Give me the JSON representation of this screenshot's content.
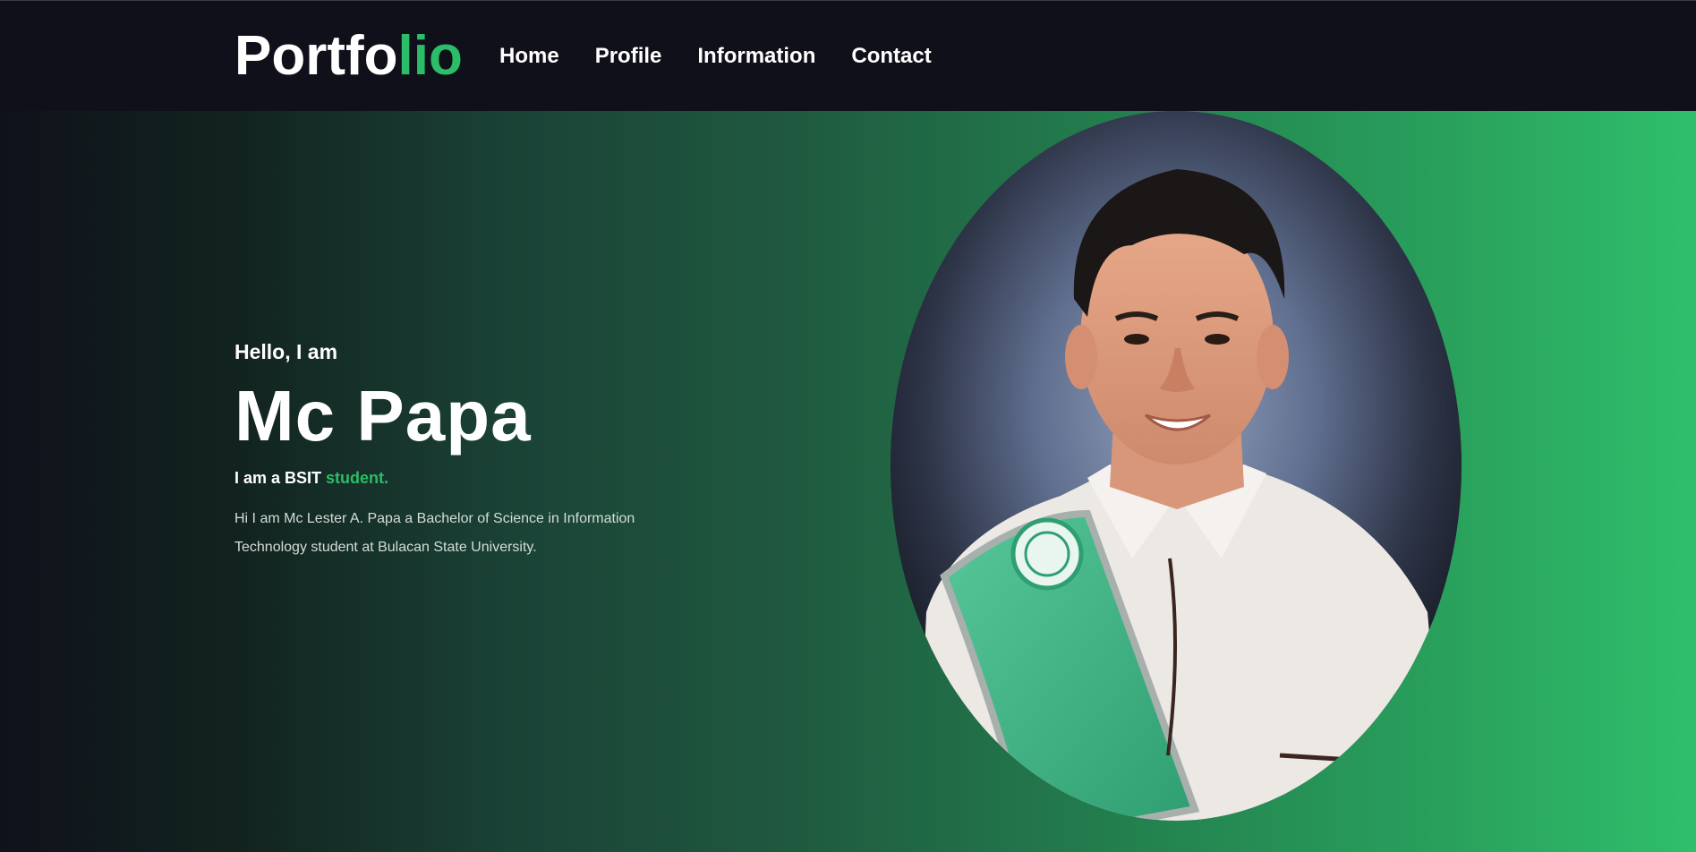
{
  "nav": {
    "logo_main": "Portfo",
    "logo_accent": "lio",
    "links": [
      "Home",
      "Profile",
      "Information",
      "Contact"
    ]
  },
  "hero": {
    "greeting": "Hello, I am",
    "name": "Mc Papa",
    "role_prefix": "I am a BSIT ",
    "role_accent": "student.",
    "bio": "Hi I am Mc Lester A. Papa a Bachelor of Science in Information Technology student at Bulacan State University."
  },
  "colors": {
    "accent": "#2bbd67",
    "navbar_bg": "#10101a",
    "gradient_start": "#0f121b",
    "gradient_end": "#2fbf6b"
  }
}
